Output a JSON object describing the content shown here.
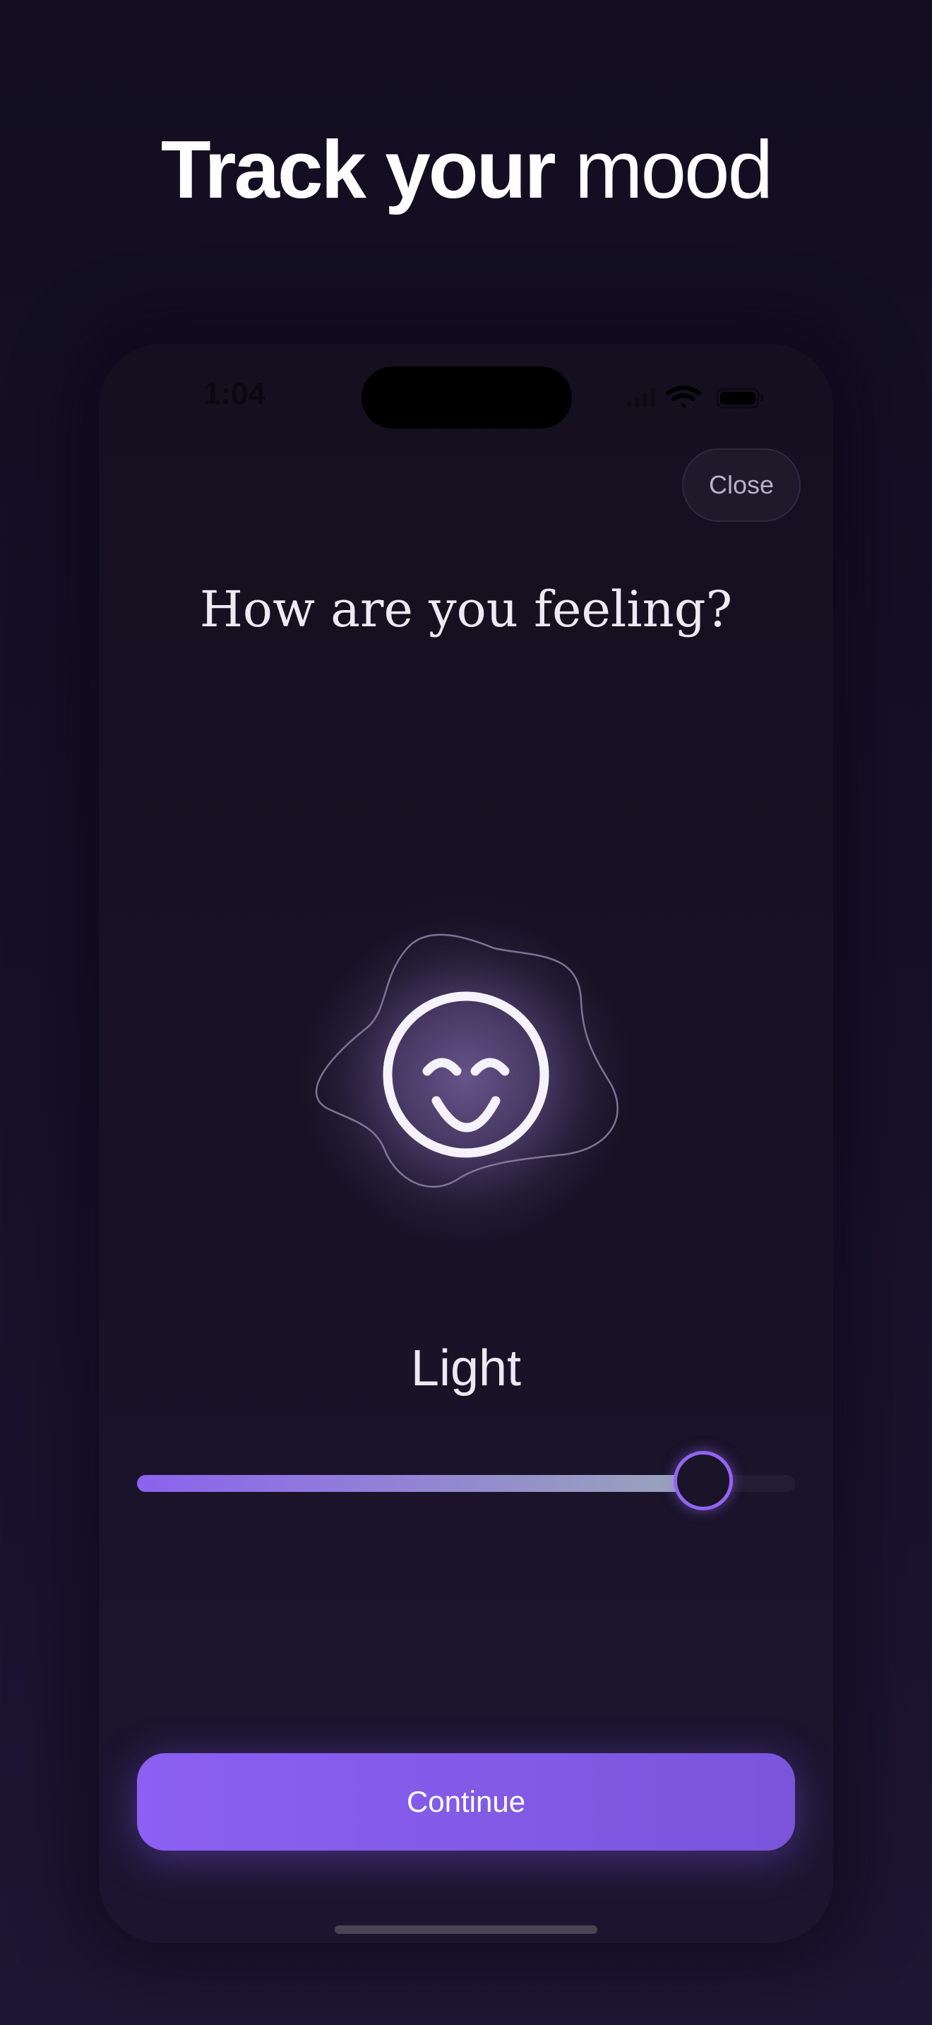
{
  "headline": {
    "strong": "Track your",
    "light": "mood"
  },
  "status_bar": {
    "time": "1:04",
    "icons": [
      "signal-icon",
      "wifi-icon",
      "battery-icon"
    ]
  },
  "header": {
    "close_label": "Close"
  },
  "main": {
    "question": "How are you feeling?",
    "mood_icon": "smiling-face-icon",
    "mood_label": "Light",
    "slider_value": 0.86
  },
  "footer": {
    "continue_label": "Continue"
  },
  "colors": {
    "accent": "#8b60f2",
    "background": "#161027",
    "slider_end": "#9aa6b8"
  }
}
